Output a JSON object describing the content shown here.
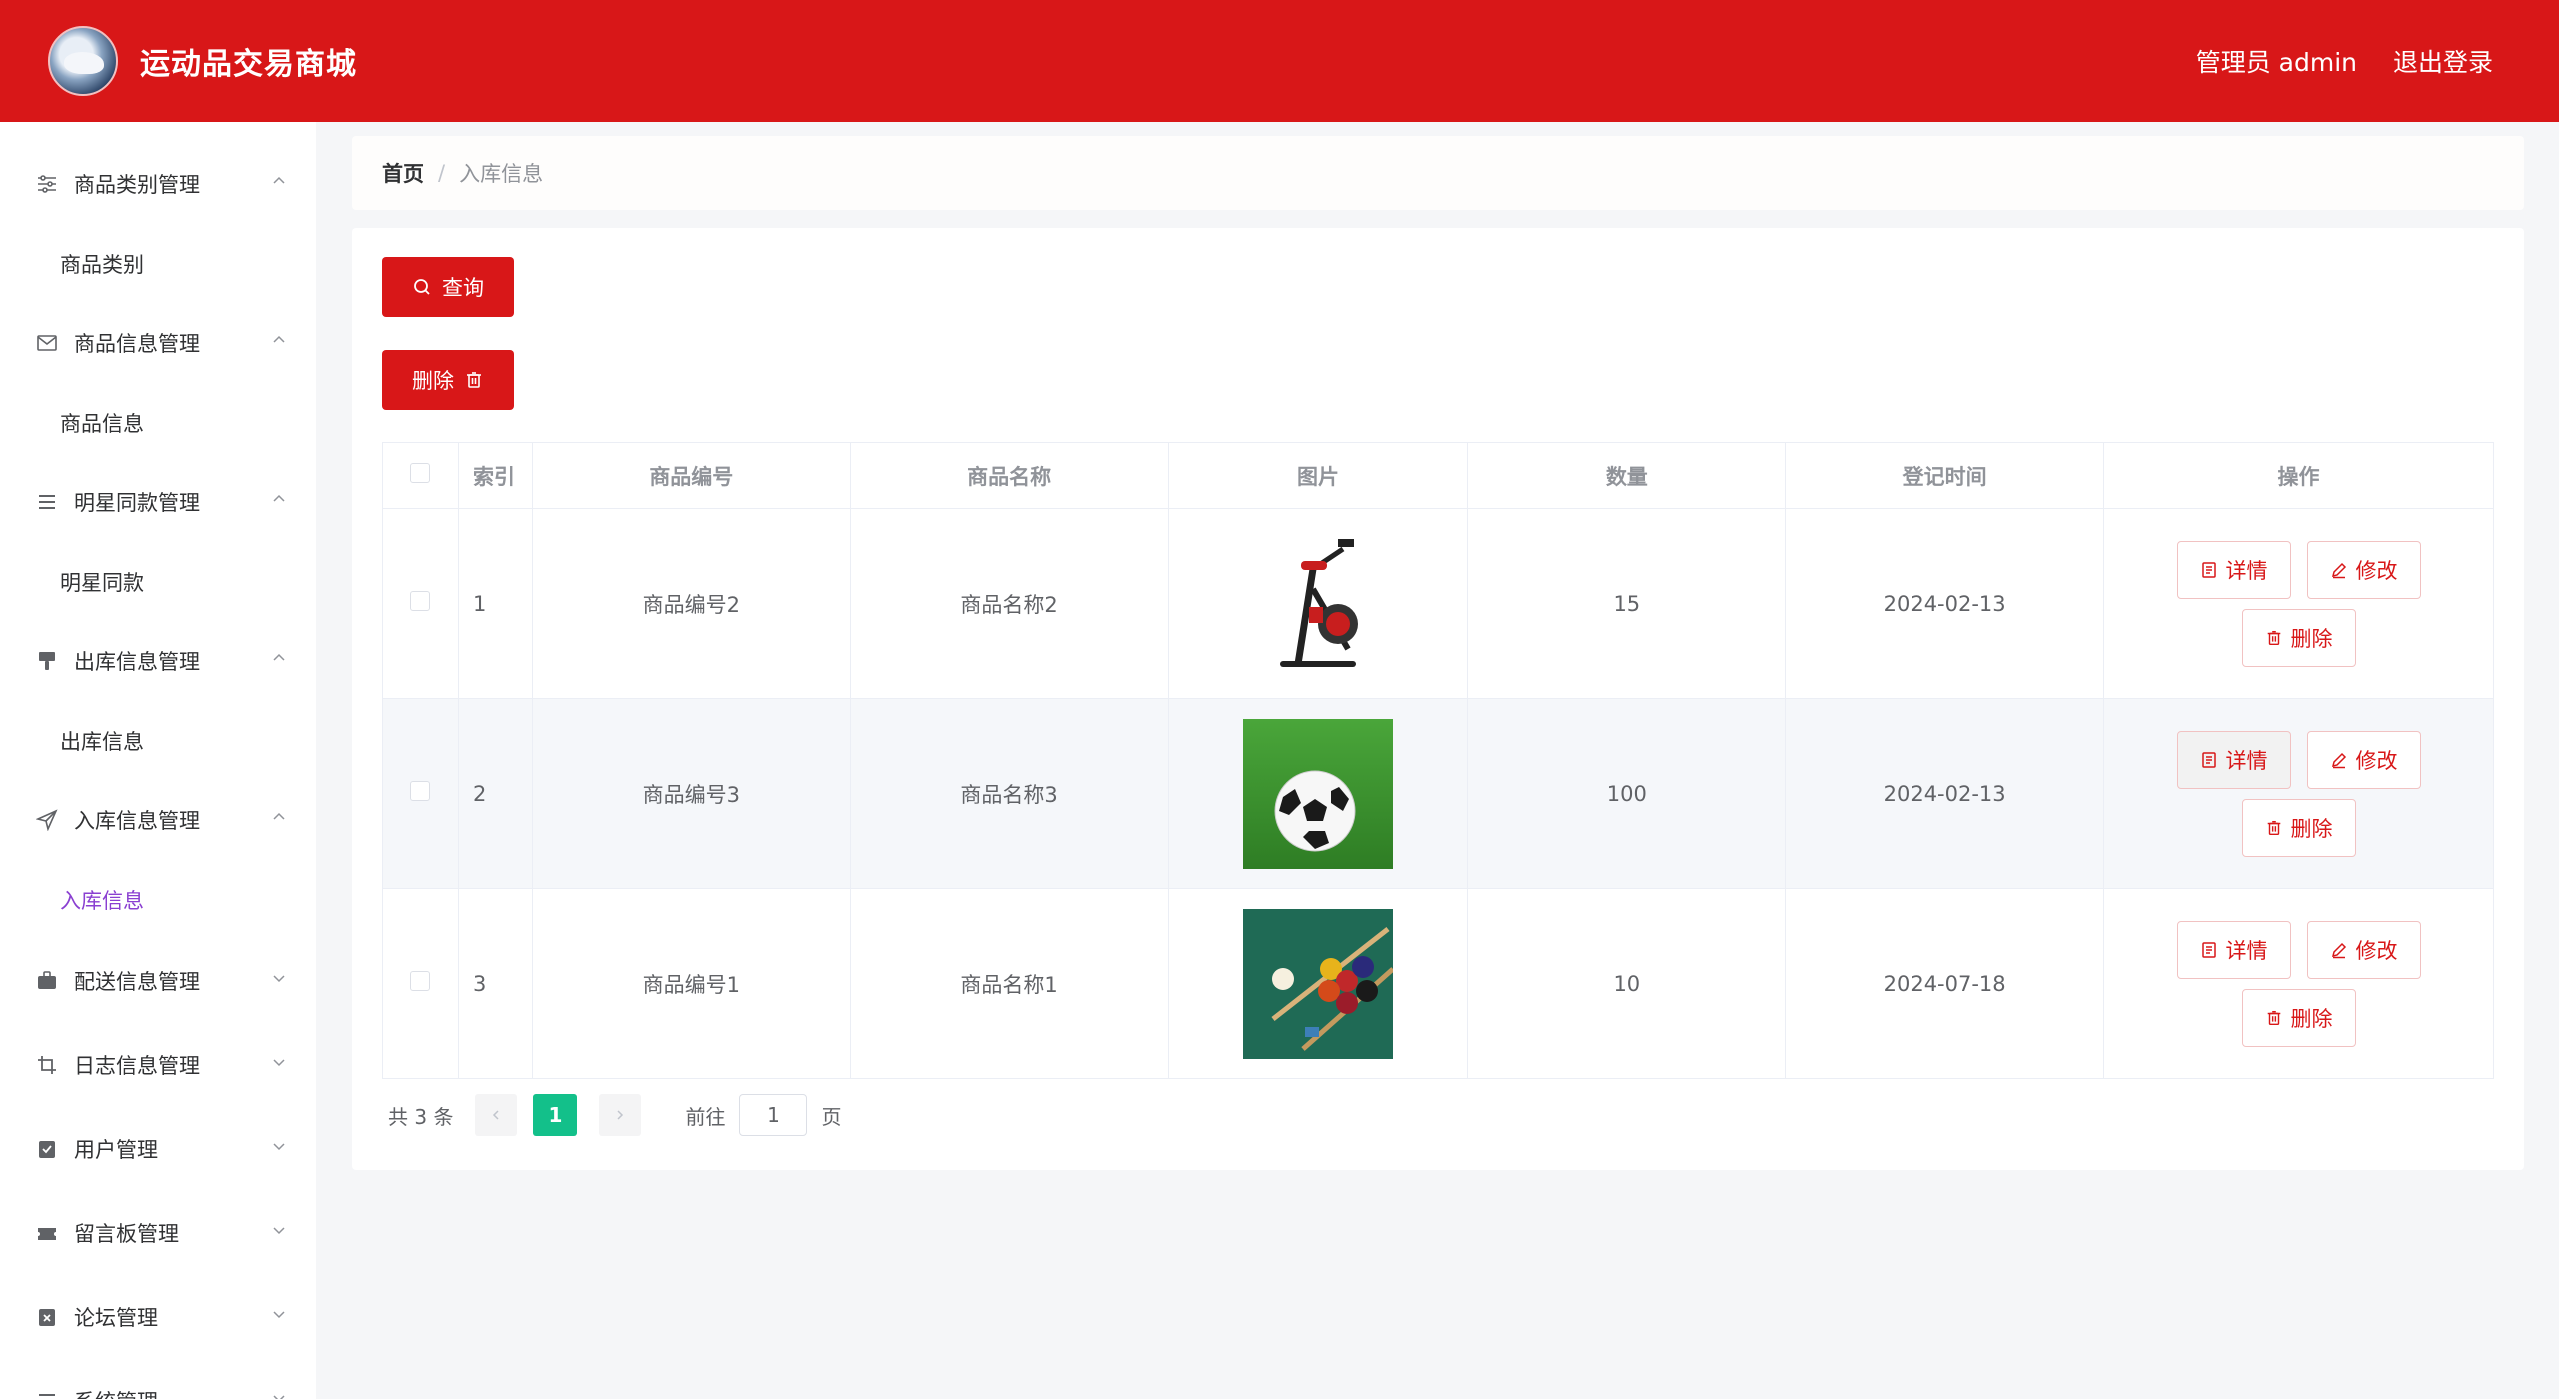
{
  "header": {
    "title": "运动品交易商城",
    "user_label": "管理员 admin",
    "logout_label": "退出登录"
  },
  "sidebar": {
    "groups": [
      {
        "label": "商品类别管理",
        "icon": "sliders-icon",
        "expanded": true,
        "sub": "商品类别"
      },
      {
        "label": "商品信息管理",
        "icon": "mail-icon",
        "expanded": true,
        "sub": "商品信息"
      },
      {
        "label": "明星同款管理",
        "icon": "list-icon",
        "expanded": true,
        "sub": "明星同款"
      },
      {
        "label": "出库信息管理",
        "icon": "brush-icon",
        "expanded": true,
        "sub": "出库信息"
      },
      {
        "label": "入库信息管理",
        "icon": "send-icon",
        "expanded": true,
        "sub": "入库信息"
      },
      {
        "label": "配送信息管理",
        "icon": "briefcase-icon",
        "expanded": false
      },
      {
        "label": "日志信息管理",
        "icon": "crop-icon",
        "expanded": false
      },
      {
        "label": "用户管理",
        "icon": "clipboard-check-icon",
        "expanded": false
      },
      {
        "label": "留言板管理",
        "icon": "ticket-icon",
        "expanded": false
      },
      {
        "label": "论坛管理",
        "icon": "clipboard-x-icon",
        "expanded": false
      },
      {
        "label": "系统管理",
        "icon": "list-icon",
        "expanded": false
      }
    ]
  },
  "breadcrumb": {
    "home": "首页",
    "separator": "/",
    "current": "入库信息"
  },
  "toolbar": {
    "query_label": "查询",
    "delete_label": "删除"
  },
  "table": {
    "columns": [
      "索引",
      "商品编号",
      "商品名称",
      "图片",
      "数量",
      "登记时间",
      "操作"
    ],
    "rows": [
      {
        "index": "1",
        "code": "商品编号2",
        "name": "商品名称2",
        "image": "exercise-bike",
        "qty": "15",
        "date": "2024-02-13"
      },
      {
        "index": "2",
        "code": "商品编号3",
        "name": "商品名称3",
        "image": "soccer-ball",
        "qty": "100",
        "date": "2024-02-13"
      },
      {
        "index": "3",
        "code": "商品编号1",
        "name": "商品名称1",
        "image": "billiards",
        "qty": "10",
        "date": "2024-07-18"
      }
    ],
    "actions": {
      "detail": "详情",
      "edit": "修改",
      "delete": "删除"
    }
  },
  "pagination": {
    "total_label": "共 3 条",
    "current_page": "1",
    "goto_label": "前往",
    "goto_value": "1",
    "page_suffix": "页"
  },
  "colors": {
    "brand": "#d81718",
    "active_menu": "#8a3fd1",
    "pager_active": "#13c08a"
  }
}
